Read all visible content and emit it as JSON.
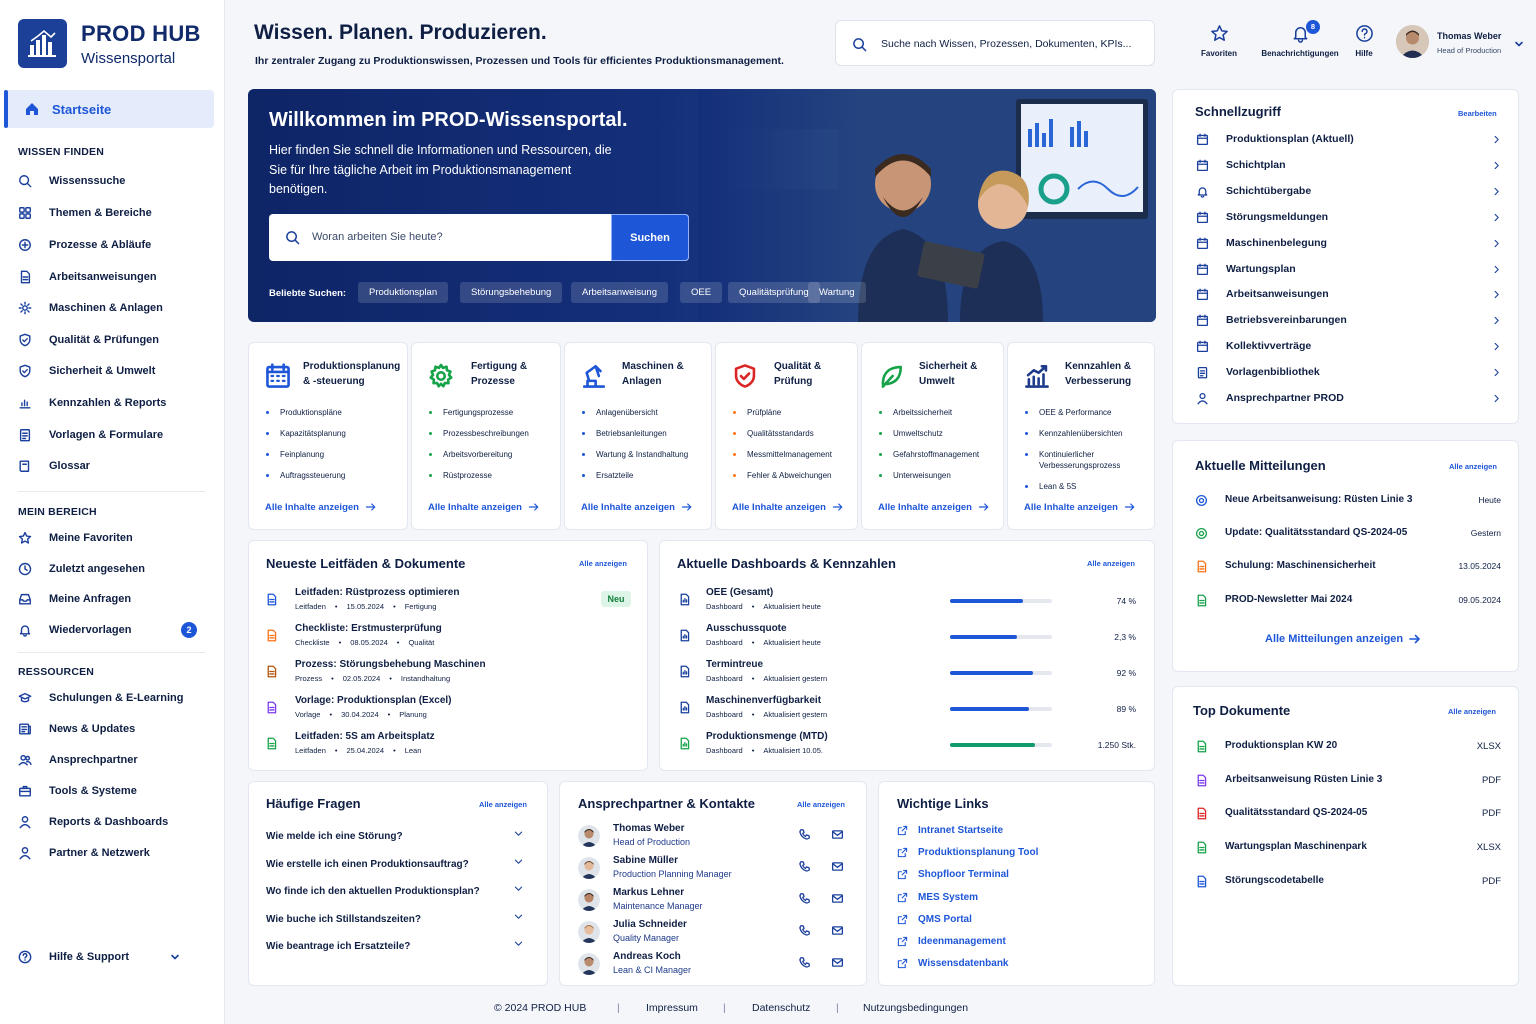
{
  "brand": {
    "name": "PROD HUB",
    "subtitle": "Wissensportal"
  },
  "sidebar": {
    "active": "Startseite",
    "sections": [
      {
        "title": "WISSEN FINDEN",
        "items": [
          "Wissenssuche",
          "Themen & Bereiche",
          "Prozesse & Abläufe",
          "Arbeitsanweisungen",
          "Maschinen & Anlagen",
          "Qualität & Prüfungen",
          "Sicherheit & Umwelt",
          "Kennzahlen & Reports",
          "Vorlagen & Formulare",
          "Glossar"
        ]
      },
      {
        "title": "MEIN BEREICH",
        "items": [
          "Meine Favoriten",
          "Zuletzt angesehen",
          "Meine Anfragen",
          "Wiedervorlagen"
        ]
      },
      {
        "title": "RESSOURCEN",
        "items": [
          "Schulungen & E-Learning",
          "News & Updates",
          "Ansprechpartner",
          "Tools & Systeme",
          "Reports & Dashboards",
          "Partner & Netzwerk"
        ]
      }
    ],
    "wiedervorlagen_badge": "2",
    "help": "Hilfe & Support"
  },
  "header": {
    "title": "Wissen. Planen. Produzieren.",
    "subtitle": "Ihr zentraler Zugang zu Produktionswissen, Prozessen und Tools für efficientes Produktionsmanagement.",
    "search_placeholder": "Suche nach Wissen, Prozessen, Dokumenten, KPIs...",
    "favorites": "Favoriten",
    "notifications": "Benachrichtigungen",
    "notif_count": "8",
    "help": "Hilfe",
    "user_name": "Thomas Weber",
    "user_role": "Head of Production"
  },
  "hero": {
    "title": "Willkommen im PROD-Wissensportal.",
    "text": "Hier finden Sie schnell die Informationen und Ressourcen, die Sie für Ihre tägliche Arbeit im Produktionsmanagement benötigen.",
    "search_placeholder": "Woran arbeiten Sie heute?",
    "search_button": "Suchen",
    "popular_label": "Beliebte Suchen:",
    "chips": [
      "Produktionsplan",
      "Störungsbehebung",
      "Arbeitsanweisung",
      "OEE",
      "Qualitätsprüfung",
      "Wartung"
    ]
  },
  "categories": [
    {
      "title": "Produktionsplanung & -steuerung",
      "items": [
        "Produktionspläne",
        "Kapazitätsplanung",
        "Feinplanung",
        "Auftragssteuerung"
      ],
      "more": "Alle Inhalte anzeigen",
      "bullet": "#1e56d8"
    },
    {
      "title": "Fertigung & Prozesse",
      "items": [
        "Fertigungsprozesse",
        "Prozessbeschreibungen",
        "Arbeitsvorbereitung",
        "Rüstprozesse"
      ],
      "more": "Alle Inhalte anzeigen",
      "bullet": "#16a34a"
    },
    {
      "title": "Maschinen & Anlagen",
      "items": [
        "Anlagenübersicht",
        "Betriebsanleitungen",
        "Wartung & Instandhaltung",
        "Ersatzteile"
      ],
      "more": "Alle Inhalte anzeigen",
      "bullet": "#1e56d8"
    },
    {
      "title": "Qualität & Prüfung",
      "items": [
        "Prüfpläne",
        "Qualitätsstandards",
        "Messmittelmanagement",
        "Fehler & Abweichungen"
      ],
      "more": "Alle Inhalte anzeigen",
      "bullet": "#f97316"
    },
    {
      "title": "Sicherheit & Umwelt",
      "items": [
        "Arbeitssicherheit",
        "Umweltschutz",
        "Gefahrstoffmanagement",
        "Unterweisungen"
      ],
      "more": "Alle Inhalte anzeigen",
      "bullet": "#16a34a"
    },
    {
      "title": "Kennzahlen & Verbesserung",
      "items": [
        "OEE & Performance",
        "Kennzahlenübersichten",
        "Kontinuierlicher Verbesserungsprozess",
        "Lean & 5S"
      ],
      "more": "Alle Inhalte anzeigen",
      "bullet": "#1e56d8"
    }
  ],
  "guides": {
    "title": "Neueste Leitfäden & Dokumente",
    "more": "Alle anzeigen",
    "new_badge": "Neu",
    "items": [
      {
        "title": "Leitfaden: Rüstprozess optimieren",
        "type": "Leitfaden",
        "date": "15.05.2024",
        "area": "Fertigung",
        "color": "#1e56d8"
      },
      {
        "title": "Checkliste: Erstmusterprüfung",
        "type": "Checkliste",
        "date": "08.05.2024",
        "area": "Qualität",
        "color": "#f97316"
      },
      {
        "title": "Prozess: Störungsbehebung Maschinen",
        "type": "Prozess",
        "date": "02.05.2024",
        "area": "Instandhaltung",
        "color": "#b45309"
      },
      {
        "title": "Vorlage: Produktionsplan (Excel)",
        "type": "Vorlage",
        "date": "30.04.2024",
        "area": "Planung",
        "color": "#7c3aed"
      },
      {
        "title": "Leitfaden: 5S am Arbeitsplatz",
        "type": "Leitfaden",
        "date": "25.04.2024",
        "area": "Lean",
        "color": "#16a34a"
      }
    ]
  },
  "dashboards": {
    "title": "Aktuelle Dashboards & Kennzahlen",
    "more": "Alle anzeigen",
    "items": [
      {
        "title": "OEE (Gesamt)",
        "type": "Dashboard",
        "status": "Aktualisiert heute",
        "value": "74 %",
        "fill": 0.72,
        "color": "#1e56d8"
      },
      {
        "title": "Ausschussquote",
        "type": "Dashboard",
        "status": "Aktualisiert heute",
        "value": "2,3 %",
        "fill": 0.66,
        "color": "#1e56d8"
      },
      {
        "title": "Termintreue",
        "type": "Dashboard",
        "status": "Aktualisiert gestern",
        "value": "92 %",
        "fill": 0.81,
        "color": "#1e56d8"
      },
      {
        "title": "Maschinenverfügbarkeit",
        "type": "Dashboard",
        "status": "Aktualisiert gestern",
        "value": "89 %",
        "fill": 0.77,
        "color": "#1e56d8"
      },
      {
        "title": "Produktionsmenge (MTD)",
        "type": "Dashboard",
        "status": "Aktualisiert 10.05.",
        "value": "1.250 Stk.",
        "fill": 0.83,
        "color": "#109b6d"
      }
    ]
  },
  "faq": {
    "title": "Häufige Fragen",
    "more": "Alle anzeigen",
    "items": [
      "Wie melde ich eine Störung?",
      "Wie erstelle ich einen Produktionsauftrag?",
      "Wo finde ich den aktuellen Produktionsplan?",
      "Wie buche ich Stillstandszeiten?",
      "Wie beantrage ich Ersatzteile?"
    ]
  },
  "contacts": {
    "title": "Ansprechpartner & Kontakte",
    "more": "Alle anzeigen",
    "items": [
      {
        "name": "Thomas Weber",
        "role": "Head of Production"
      },
      {
        "name": "Sabine Müller",
        "role": "Production Planning Manager"
      },
      {
        "name": "Markus Lehner",
        "role": "Maintenance Manager"
      },
      {
        "name": "Julia Schneider",
        "role": "Quality Manager"
      },
      {
        "name": "Andreas Koch",
        "role": "Lean & CI Manager"
      }
    ]
  },
  "links": {
    "title": "Wichtige Links",
    "items": [
      "Intranet Startseite",
      "Produktionsplanung Tool",
      "Shopfloor Terminal",
      "MES System",
      "QMS Portal",
      "Ideenmanagement",
      "Wissensdatenbank"
    ]
  },
  "quick": {
    "title": "Schnellzugriff",
    "edit": "Bearbeiten",
    "items": [
      "Produktionsplan (Aktuell)",
      "Schichtplan",
      "Schichtübergabe",
      "Störungsmeldungen",
      "Maschinenbelegung",
      "Wartungsplan",
      "Arbeitsanweisungen",
      "Betriebsvereinbarungen",
      "Kollektivverträge",
      "Vorlagenbibliothek",
      "Ansprechpartner PROD"
    ]
  },
  "news": {
    "title": "Aktuelle Mitteilungen",
    "more": "Alle anzeigen",
    "all_link": "Alle Mitteilungen anzeigen",
    "items": [
      {
        "title": "Neue Arbeitsanweisung: Rüsten Linie 3",
        "date": "Heute",
        "color": "#1e56d8"
      },
      {
        "title": "Update: Qualitätsstandard QS-2024-05",
        "date": "Gestern",
        "color": "#16a34a"
      },
      {
        "title": "Schulung: Maschinensicherheit",
        "date": "13.05.2024",
        "color": "#f97316"
      },
      {
        "title": "PROD-Newsletter Mai 2024",
        "date": "09.05.2024",
        "color": "#16a34a"
      }
    ]
  },
  "topdocs": {
    "title": "Top Dokumente",
    "more": "Alle anzeigen",
    "items": [
      {
        "title": "Produktionsplan KW 20",
        "type": "XLSX",
        "color": "#16a34a"
      },
      {
        "title": "Arbeitsanweisung Rüsten Linie 3",
        "type": "PDF",
        "color": "#7c3aed"
      },
      {
        "title": "Qualitätsstandard QS-2024-05",
        "type": "PDF",
        "color": "#dc2626"
      },
      {
        "title": "Wartungsplan Maschinenpark",
        "type": "XLSX",
        "color": "#16a34a"
      },
      {
        "title": "Störungscodetabelle",
        "type": "PDF",
        "color": "#1e56d8"
      }
    ]
  },
  "footer": {
    "copyright": "© 2024 PROD HUB",
    "links": [
      "Impressum",
      "Datenschutz",
      "Nutzungsbedingungen"
    ]
  }
}
